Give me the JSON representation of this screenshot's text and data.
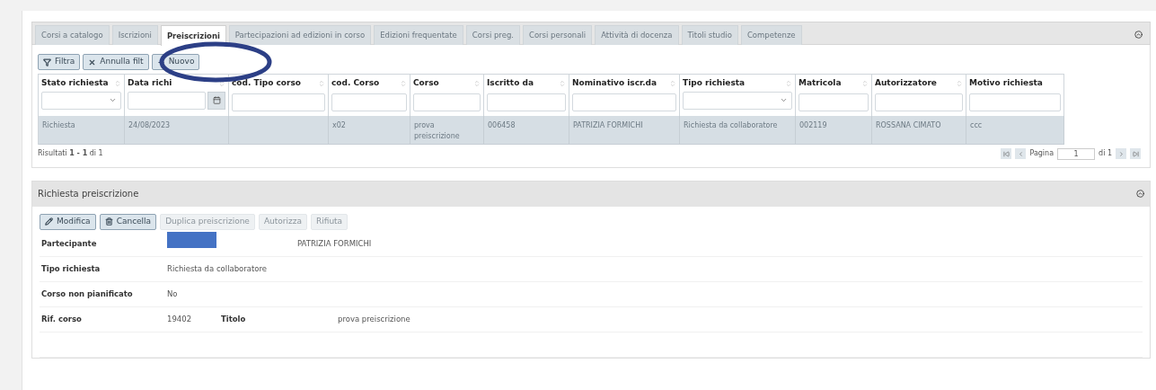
{
  "tabs": [
    {
      "label": "Corsi a catalogo",
      "selected": false
    },
    {
      "label": "Iscrizioni",
      "selected": false
    },
    {
      "label": "Preiscrizioni",
      "selected": true
    },
    {
      "label": "Partecipazioni ad edizioni in corso",
      "selected": false
    },
    {
      "label": "Edizioni frequentate",
      "selected": false
    },
    {
      "label": "Corsi preg.",
      "selected": false
    },
    {
      "label": "Corsi personali",
      "selected": false
    },
    {
      "label": "Attività di docenza",
      "selected": false
    },
    {
      "label": "Titoli studio",
      "selected": false
    },
    {
      "label": "Competenze",
      "selected": false
    }
  ],
  "toolbar": [
    {
      "label": "Filtra",
      "kind": "filter"
    },
    {
      "label": "Annulla filt",
      "kind": "clear"
    },
    {
      "label": "Nuovo",
      "kind": "new"
    }
  ],
  "table": {
    "columns": [
      {
        "label": "Stato richiesta",
        "kind": "select"
      },
      {
        "label": "Data richi",
        "kind": "date"
      },
      {
        "label": "cod. Tipo corso",
        "kind": "text"
      },
      {
        "label": "cod. Corso",
        "kind": "text"
      },
      {
        "label": "Corso",
        "kind": "text"
      },
      {
        "label": "Iscritto da",
        "kind": "text"
      },
      {
        "label": "Nominativo iscr.da",
        "kind": "text"
      },
      {
        "label": "Tipo richiesta",
        "kind": "select"
      },
      {
        "label": "Matricola",
        "kind": "text"
      },
      {
        "label": "Autorizzatore",
        "kind": "text"
      },
      {
        "label": "Motivo richiesta",
        "kind": "text"
      }
    ],
    "rows": [
      [
        "Richiesta",
        "24/08/2023",
        "",
        "x02",
        "prova preiscrizione",
        "006458",
        "PATRIZIA FORMICHI",
        "Richiesta da collaboratore",
        "002119",
        "ROSSANA CIMATO",
        "ccc"
      ]
    ]
  },
  "results": {
    "prefix": "Risultati",
    "range": "1 - 1",
    "of": "di 1"
  },
  "pager": {
    "label": "Pagina",
    "page": "1",
    "total": "di 1"
  },
  "detail": {
    "title": "Richiesta preiscrizione",
    "buttons": [
      {
        "label": "Modifica",
        "kind": "edit",
        "disabled": false
      },
      {
        "label": "Cancella",
        "kind": "delete",
        "disabled": false
      },
      {
        "label": "Duplica preiscrizione",
        "disabled": true
      },
      {
        "label": "Autorizza",
        "disabled": true
      },
      {
        "label": "Rifiuta",
        "disabled": true
      }
    ],
    "fields": [
      {
        "label": "Partecipante",
        "redacted": true,
        "value": "PATRIZIA FORMICHI"
      },
      {
        "label": "Tipo richiesta",
        "value": "Richiesta da collaboratore"
      },
      {
        "label": "Corso non pianificato",
        "value": "No"
      },
      {
        "label": "Rif. corso",
        "value": "19402",
        "extra_label": "Titolo",
        "extra_value": "prova preiscrizione"
      }
    ]
  }
}
